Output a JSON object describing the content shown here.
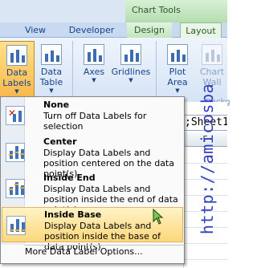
{
  "ribbon": {
    "contextual_tab": "Chart Tools",
    "tabs": [
      "View",
      "Developer",
      "Design",
      "Layout"
    ],
    "buttons": {
      "data_labels": [
        "Data",
        "Labels"
      ],
      "data_table": [
        "Data",
        "Table"
      ],
      "axes": "Axes",
      "gridlines": "Gridlines",
      "plot_area": [
        "Plot",
        "Area"
      ],
      "chart_wall": [
        "Chart",
        "Wall"
      ]
    },
    "group_hint": "Backg"
  },
  "sheet": {
    "formula_text": ";Sheet1",
    "column_header": "F"
  },
  "menu": {
    "items": [
      {
        "title": "None",
        "desc": "Turn off Data Labels for selection"
      },
      {
        "title": "Center",
        "desc": "Display Data Labels and position centered on the data point(s)"
      },
      {
        "title": "Inside End",
        "desc": "Display Data Labels and position inside the end of data point(s)"
      },
      {
        "title": "Inside Base",
        "desc": "Display Data Labels and position inside the base of data point(s)"
      }
    ],
    "more_label": "More Data Label Options..."
  },
  "watermark": "http://amicosba"
}
